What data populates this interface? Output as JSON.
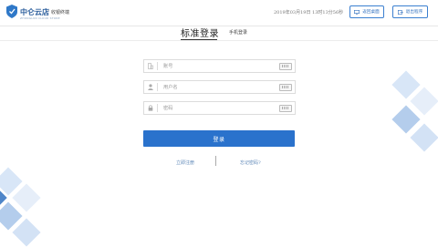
{
  "header": {
    "brand_name": "中仑云店",
    "brand_sub": "ZHONGLUN CLOUD STORE",
    "separator": "·",
    "terminal_label": "收银终端",
    "datetime": "2019年03月19日 13时13分56秒",
    "desktop_button": "返回桌面",
    "exit_button": "退出程序"
  },
  "tabs": {
    "standard": "标准登录",
    "phone": "手机登录"
  },
  "form": {
    "account_placeholder": "账号",
    "username_placeholder": "用户名",
    "password_placeholder": "密码",
    "login_button": "登录"
  },
  "links": {
    "register": "立即注册",
    "forgot": "忘记密码?"
  },
  "colors": {
    "accent": "#2a72cc",
    "brand": "#2a5d9c",
    "deco_light": "#d8e6f7",
    "deco_mid": "#b4cdec",
    "deco_dark": "#4f86c9"
  }
}
